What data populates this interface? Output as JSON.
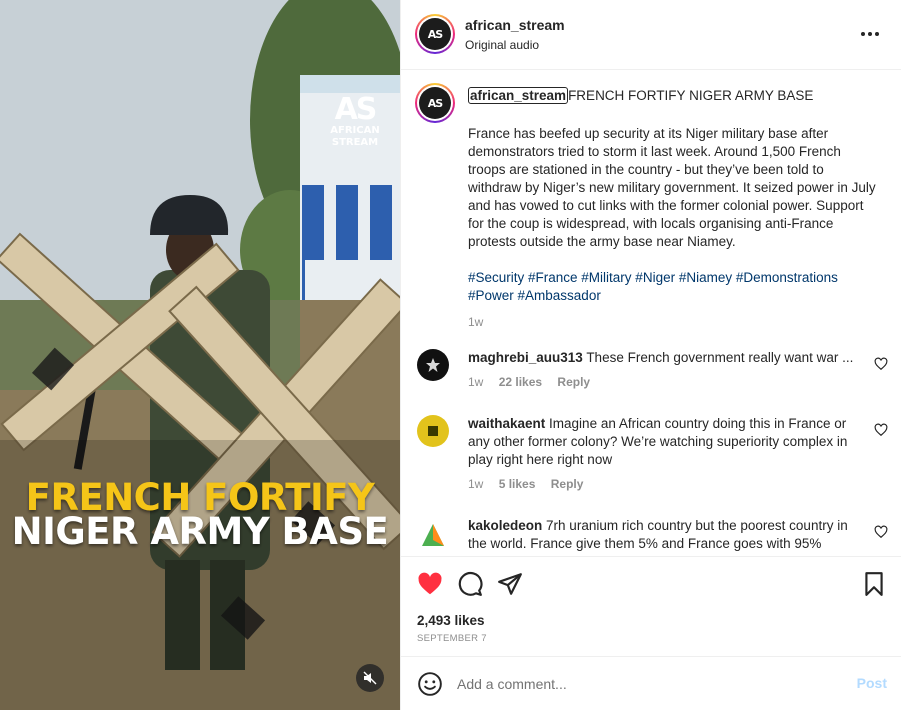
{
  "media": {
    "headline_line1": "FRENCH FORTIFY",
    "headline_line2": "NIGER ARMY BASE",
    "logo_mark": "AS",
    "logo_line1": "AFRICAN",
    "logo_line2": "STREAM",
    "mute_icon": "speaker-muted-icon"
  },
  "header": {
    "username": "african_stream",
    "subtitle": "Original audio",
    "avatar_text": "AS",
    "more_icon": "more-horizontal-icon"
  },
  "caption": {
    "username": "african_stream",
    "title": "FRENCH FORTIFY NIGER ARMY BASE",
    "body": "France has beefed up security at its Niger military base after demonstrators tried to storm it last week. Around 1,500 French troops are stationed in the country - but they’ve been told to withdraw by Niger’s new military government. It seized power in July and has vowed to cut links with the former colonial power. Support for the coup is widespread, with locals organising anti-France protests outside the army base near Niamey.",
    "hashtags": "#Security #France #Military #Niger #Niamey #Demonstrations #Power #Ambassador",
    "time": "1w"
  },
  "comments": [
    {
      "username": "maghrebi_auu313",
      "text": "These French government really want war ...",
      "time": "1w",
      "likes": "22 likes",
      "reply": "Reply"
    },
    {
      "username": "waithakaent",
      "text": "Imagine an African country doing this in France or any other former colony? We’re watching superiority complex in play right here right now",
      "time": "1w",
      "likes": "5 likes",
      "reply": "Reply"
    },
    {
      "username": "kakoledeon",
      "text": "7rh uranium rich country but the poorest country in the world. France give them 5% and France goes with 95%",
      "time": "",
      "likes": "",
      "reply": ""
    }
  ],
  "actions": {
    "like_icon": "heart-filled-icon",
    "comment_icon": "comment-icon",
    "share_icon": "share-icon",
    "save_icon": "bookmark-icon",
    "likes_count": "2,493 likes",
    "date": "SEPTEMBER 7"
  },
  "composer": {
    "placeholder": "Add a comment...",
    "post_label": "Post",
    "emoji_icon": "emoji-icon"
  },
  "colors": {
    "like_red": "#ff3040",
    "link_blue": "#00376b",
    "headline_yellow": "#f5c518",
    "post_disabled": "#b3dbff"
  }
}
